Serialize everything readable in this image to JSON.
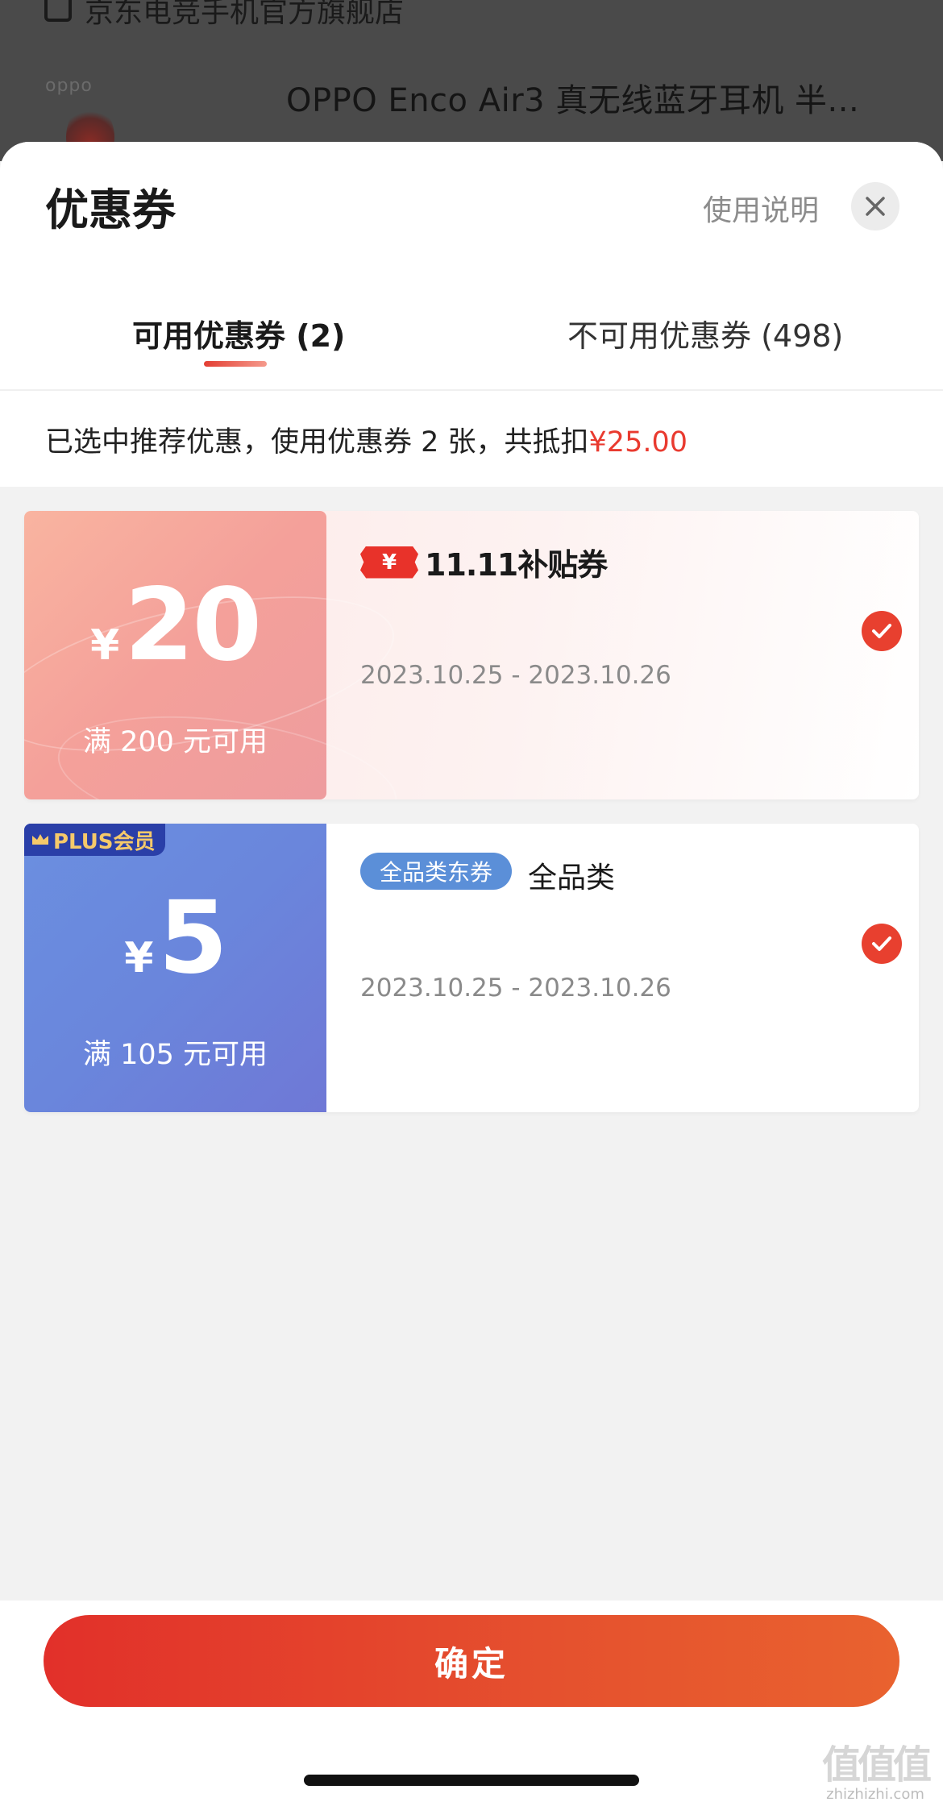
{
  "background": {
    "store_name": "京东电竞手机官方旗舰店",
    "brand_logo": "oppo",
    "product_title": "OPPO Enco Air3 真无线蓝牙耳机 半..."
  },
  "sheet": {
    "title": "优惠券",
    "help_label": "使用说明",
    "close_icon": "close-icon"
  },
  "tabs": [
    {
      "label": "可用优惠券 (2)",
      "active": true
    },
    {
      "label": "不可用优惠券 (498)",
      "active": false
    }
  ],
  "summary": {
    "text": "已选中推荐优惠，使用优惠券 2 张，共抵扣",
    "amount": "¥25.00"
  },
  "coupons": [
    {
      "currency": "¥",
      "value": "20",
      "condition": "满 200 元可用",
      "badge_yen": "¥",
      "badge_text": "11.11补贴券",
      "dates": "2023.10.25 - 2023.10.26",
      "selected": true
    },
    {
      "plus_badge": "PLUS会员",
      "currency": "¥",
      "value": "5",
      "condition": "满 105 元可用",
      "category_badge": "全品类东券",
      "category_label": "全品类",
      "dates": "2023.10.25 - 2023.10.26",
      "selected": true
    }
  ],
  "confirm_label": "确定",
  "watermark": {
    "mark": "值值值",
    "site": "zhizhizhi.com"
  },
  "colors": {
    "accent_red": "#e8402f",
    "plus_blue": "#6b86dc",
    "coupon_peach": "#f4a09a"
  }
}
